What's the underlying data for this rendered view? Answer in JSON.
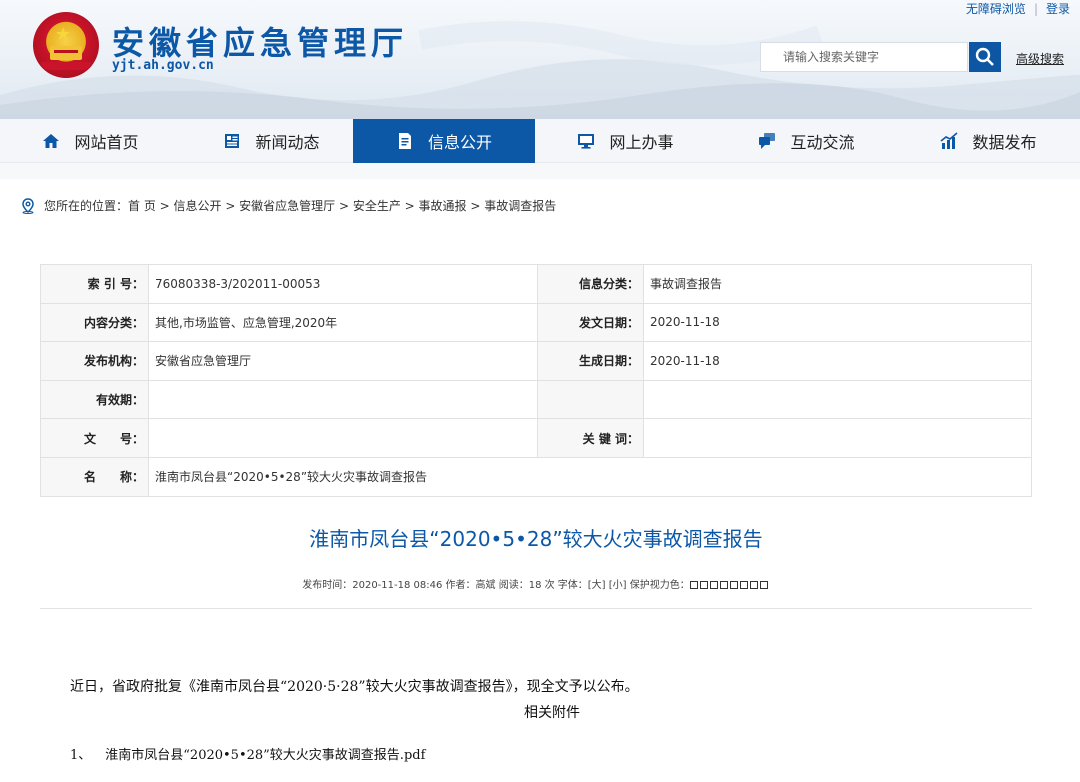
{
  "header": {
    "title": "安徽省应急管理厅",
    "domain": "yjt.ah.gov.cn",
    "top_links": [
      "无障碍浏览",
      "登录"
    ],
    "search_placeholder": "请输入搜索关键字",
    "advanced_search": "高级搜索"
  },
  "nav": {
    "items": [
      {
        "label": "网站首页",
        "icon": "home-icon"
      },
      {
        "label": "新闻动态",
        "icon": "news-icon"
      },
      {
        "label": "信息公开",
        "icon": "document-icon",
        "active": true
      },
      {
        "label": "网上办事",
        "icon": "monitor-icon"
      },
      {
        "label": "互动交流",
        "icon": "chat-icon"
      },
      {
        "label": "数据发布",
        "icon": "chart-icon"
      }
    ]
  },
  "breadcrumb": "您所在的位置：首 页 > 信息公开 > 安徽省应急管理厅 > 安全生产 > 事故通报 > 事故调查报告",
  "meta": {
    "index_no_label": "索 引 号：",
    "index_no": "76080338-3/202011-00053",
    "info_category_label": "信息分类：",
    "info_category": "事故调查报告",
    "content_category_label": "内容分类：",
    "content_category": "其他,市场监管、应急管理,2020年",
    "issue_date_label": "发文日期：",
    "issue_date": "2020-11-18",
    "publisher_label": "发布机构：",
    "publisher": "安徽省应急管理厅",
    "gen_date_label": "生成日期：",
    "gen_date": "2020-11-18",
    "validity_label": "有效期：",
    "validity": "",
    "doc_no_label": "文　　号：",
    "doc_no": "",
    "keywords_label": "关 键 词：",
    "keywords": "",
    "name_label": "名　　称：",
    "name": "淮南市凤台县“2020•5•28”较大火灾事故调查报告"
  },
  "article": {
    "title": "淮南市凤台县“2020•5•28”较大火灾事故调查报告",
    "info": "发布时间：2020-11-18 08:46  作者：高斌   阅读：18 次   字体：[大] [小]  保护视力色：",
    "body": "近日，省政府批复《淮南市凤台县“2020·5·28”较大火灾事故调查报告》，现全文予以公布。",
    "attach_title": "相关附件",
    "attachment_no": "1、",
    "attachment_name": "淮南市凤台县“2020•5•28”较大火灾事故调查报告.pdf"
  },
  "colors": {
    "brand": "#0c58a7",
    "nav_active": "#0c58a7"
  }
}
